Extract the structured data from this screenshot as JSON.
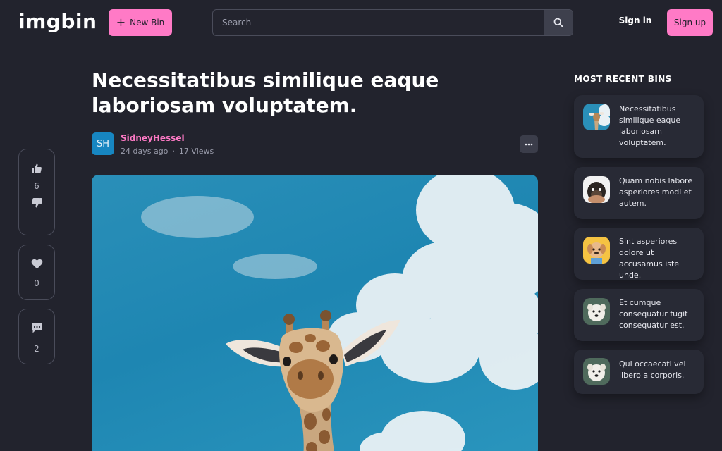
{
  "header": {
    "logo": "imgbin",
    "new_bin_label": "New Bin",
    "search_placeholder": "Search",
    "signin_label": "Sign in",
    "signup_label": "Sign up"
  },
  "actions": {
    "likes": "6",
    "favorites": "0",
    "comments": "2"
  },
  "post": {
    "title": "Necessitatibus similique eaque laboriosam voluptatem.",
    "avatar_initials": "SH",
    "author": "SidneyHessel",
    "time": "24 days ago",
    "views": "17 Views"
  },
  "sidebar": {
    "title": "MOST RECENT BINS",
    "bins": [
      {
        "text": "Necessitatibus similique eaque laboriosam voluptatem.",
        "thumb": "giraffe"
      },
      {
        "text": "Quam nobis labore asperiores modi et autem.",
        "thumb": "pug"
      },
      {
        "text": "Sint asperiores dolore ut accusamus iste unde.",
        "thumb": "puppy"
      },
      {
        "text": "Et cumque consequatur fugit consequatur est.",
        "thumb": "white-dog"
      },
      {
        "text": "Qui occaecati vel libero a corporis.",
        "thumb": "white-dog"
      }
    ]
  },
  "colors": {
    "accent": "#ff7ac6",
    "background": "#22232d",
    "card": "#282a35",
    "avatar": "#1786c1"
  }
}
